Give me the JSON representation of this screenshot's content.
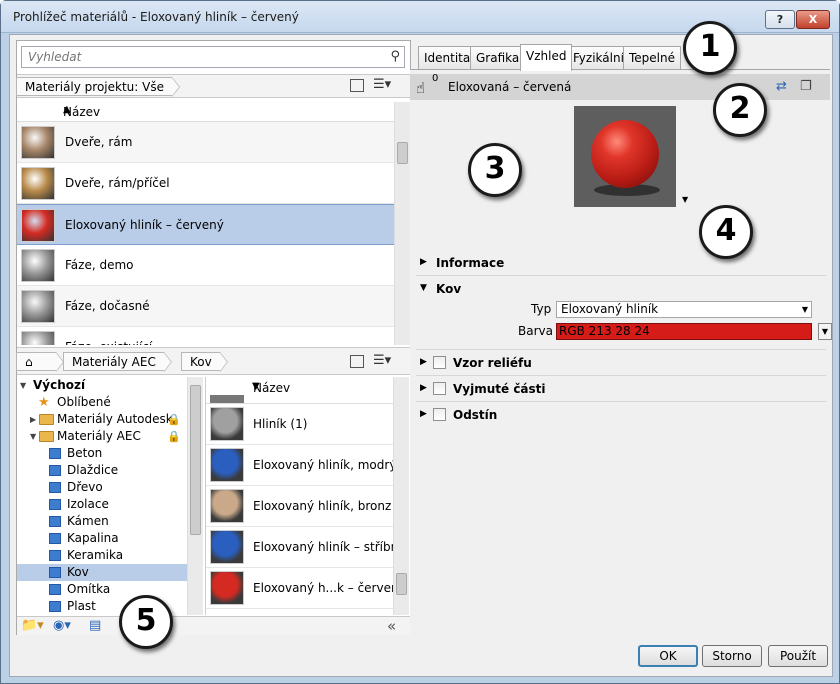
{
  "window": {
    "title": "Prohlížeč materiálů - Eloxovaný hliník – červený",
    "help_label": "?",
    "close_label": "X"
  },
  "search": {
    "placeholder": "Vyhledat"
  },
  "project_bar": {
    "crumb": "Materiály projektu: Vše"
  },
  "project_list": {
    "header": "Název",
    "items": [
      {
        "label": "Dveře, rám",
        "thumb": "#a8876a"
      },
      {
        "label": "Dveře, rám/příčel",
        "thumb": "#b88a4a"
      },
      {
        "label": "Eloxovaný hliník – červený",
        "thumb": "#d42a22",
        "selected": true
      },
      {
        "label": "Fáze, demo",
        "thumb": "#9a9a9a"
      },
      {
        "label": "Fáze, dočasné",
        "thumb": "#9a9a9a"
      },
      {
        "label": "Fáze, existující",
        "thumb": "#9a9a9a"
      }
    ]
  },
  "library_bar": {
    "crumbs": [
      "Materiály AEC",
      "Kov"
    ]
  },
  "tree": {
    "items": [
      {
        "label": "Výchozí",
        "kind": "root"
      },
      {
        "label": "Oblíbené",
        "kind": "star"
      },
      {
        "label": "Materiály Autodesk",
        "kind": "folder-collapsed",
        "locked": true
      },
      {
        "label": "Materiály AEC",
        "kind": "folder-open",
        "locked": true
      },
      {
        "label": "Beton",
        "kind": "mat"
      },
      {
        "label": "Dlaždice",
        "kind": "mat"
      },
      {
        "label": "Dřevo",
        "kind": "mat"
      },
      {
        "label": "Izolace",
        "kind": "mat"
      },
      {
        "label": "Kámen",
        "kind": "mat"
      },
      {
        "label": "Kapalina",
        "kind": "mat"
      },
      {
        "label": "Keramika",
        "kind": "mat"
      },
      {
        "label": "Kov",
        "kind": "mat",
        "selected": true
      },
      {
        "label": "Omítka",
        "kind": "mat"
      },
      {
        "label": "Plast",
        "kind": "mat"
      }
    ]
  },
  "library_list": {
    "header": "Název",
    "items": [
      {
        "label": "Hliník (1)",
        "thumb": "#a0a0a0"
      },
      {
        "label": "Eloxovaný hliník, modrý",
        "thumb": "#2a5fc0"
      },
      {
        "label": "Eloxovaný hliník, bronz",
        "thumb": "#c9a98a"
      },
      {
        "label": "Eloxovaný hliník – stříbrný",
        "thumb": "#2a5fc0"
      },
      {
        "label": "Eloxovaný h...k – červený",
        "thumb": "#d42a22"
      }
    ]
  },
  "tabs": [
    {
      "label": "Identita"
    },
    {
      "label": "Grafika"
    },
    {
      "label": "Vzhled",
      "active": true
    },
    {
      "label": "Fyzikální"
    },
    {
      "label": "Tepelné"
    }
  ],
  "asset": {
    "count": "0",
    "name": "Eloxovaná – červená"
  },
  "sections": {
    "informace": "Informace",
    "kov": "Kov",
    "vzor": "Vzor reliéfu",
    "vyjmute": "Vyjmuté části",
    "odstin": "Odstín"
  },
  "props": {
    "typ_label": "Typ",
    "typ_value": "Eloxovaný hliník",
    "barva_label": "Barva",
    "barva_value": "RGB 213 28 24",
    "barva_color": "#d51c18"
  },
  "buttons": {
    "ok": "OK",
    "cancel": "Storno",
    "apply": "Použít"
  },
  "callouts": [
    "1",
    "2",
    "3",
    "4",
    "5"
  ]
}
